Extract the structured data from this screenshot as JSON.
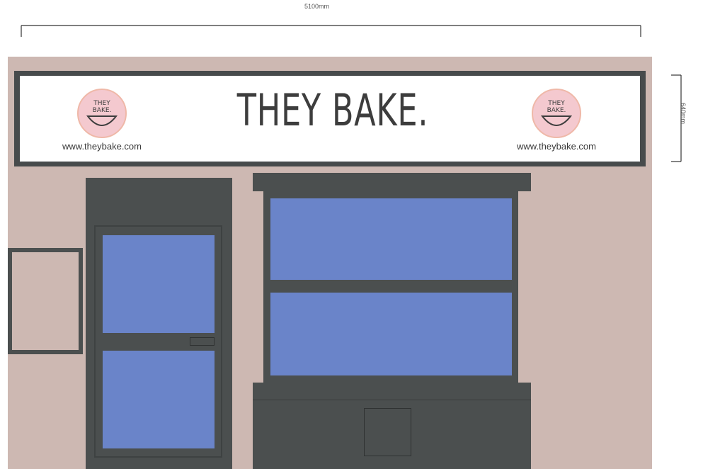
{
  "dimensions": {
    "width_label": "5100mm",
    "height_label": "640mm"
  },
  "sign": {
    "brand_name": "THEY BAKE.",
    "website_left": "www.theybake.com",
    "website_right": "www.theybake.com",
    "logo_text_line1": "THEY",
    "logo_text_line2": "BAKE."
  },
  "colors": {
    "wall": "#cdb8b2",
    "frame": "#4b4f4f",
    "glass": "#6a84c9",
    "logo_pink": "#f4c9cf"
  }
}
